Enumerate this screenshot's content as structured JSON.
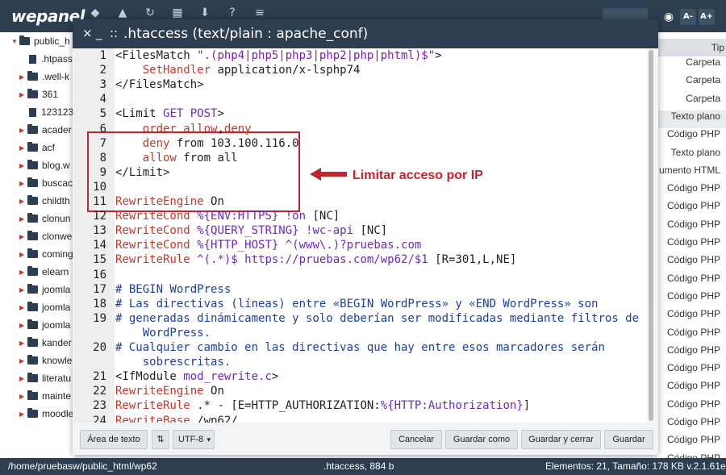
{
  "topbar": {
    "logo": "wepanel",
    "icons": [
      "home-icon",
      "upload-icon",
      "refresh-icon",
      "grid-icon",
      "download-icon",
      "help-icon",
      "settings-icon"
    ],
    "font_decrease": "A-",
    "font_increase": "A+"
  },
  "tree": {
    "items": [
      {
        "label": "public_h",
        "type": "folder",
        "expanded": true
      },
      {
        "label": ".htpass",
        "type": "file"
      },
      {
        "label": ".well-k",
        "type": "folder"
      },
      {
        "label": "361",
        "type": "folder"
      },
      {
        "label": "123123",
        "type": "file"
      },
      {
        "label": "acader",
        "type": "folder"
      },
      {
        "label": "acf",
        "type": "folder"
      },
      {
        "label": "blog.w",
        "type": "folder"
      },
      {
        "label": "buscac",
        "type": "folder"
      },
      {
        "label": "childth",
        "type": "folder"
      },
      {
        "label": "clonun",
        "type": "folder"
      },
      {
        "label": "clonwe",
        "type": "folder"
      },
      {
        "label": "coming",
        "type": "folder"
      },
      {
        "label": "elearn",
        "type": "folder"
      },
      {
        "label": "joomla",
        "type": "folder"
      },
      {
        "label": "joomla",
        "type": "folder"
      },
      {
        "label": "joomla",
        "type": "folder"
      },
      {
        "label": "kander",
        "type": "folder"
      },
      {
        "label": "knowle",
        "type": "folder"
      },
      {
        "label": "literatu",
        "type": "folder"
      },
      {
        "label": "mainte",
        "type": "folder"
      },
      {
        "label": "moodle",
        "type": "folder"
      }
    ]
  },
  "list": {
    "header": "Tip",
    "rows": [
      "Carpeta",
      "Carpeta",
      "Carpeta",
      "Texto plano",
      "Código PHP",
      "Texto plano",
      "umento HTML",
      "Código PHP",
      "Código PHP",
      "Código PHP",
      "Código PHP",
      "Código PHP",
      "Código PHP",
      "Código PHP",
      "Código PHP",
      "Código PHP",
      "Código PHP",
      "Código PHP",
      "Código PHP",
      "Código PHP",
      "Código PHP",
      "Código PHP",
      "Código PHP"
    ]
  },
  "status": {
    "path": "/home/pruebasw/public_html/wp62",
    "file": ".htaccess, 884 b",
    "summary": "Elementos: 21, Tamaño: 178 KB v.2.1.61e"
  },
  "modal": {
    "close": "×",
    "minimize": "_",
    "fullscreen": "::",
    "title": ".htaccess (text/plain : apache_conf)",
    "annotation": "Limitar acceso por IP",
    "footer": {
      "textarea_btn": "Área de texto",
      "encoding": "UTF-8",
      "cancel": "Cancelar",
      "save_as": "Guardar como",
      "save_close": "Guardar y cerrar",
      "save": "Guardar"
    }
  },
  "code": {
    "line_numbers": [
      "1",
      "2",
      "3",
      "4",
      "5",
      "6",
      "7",
      "8",
      "9",
      "10",
      "11",
      "12",
      "13",
      "14",
      "15",
      "16",
      "17",
      "18",
      "19",
      "",
      "20",
      "",
      "21",
      "22",
      "23",
      "24"
    ],
    "lines": [
      [
        {
          "t": "<FilesMatch ",
          "c": "t"
        },
        {
          "t": "\".(php4|php5|php3|php2|php|phtml)$\"",
          "c": "s"
        },
        {
          "t": ">",
          "c": "t"
        }
      ],
      [
        {
          "t": "    SetHandler ",
          "c": "k"
        },
        {
          "t": "application/x-lsphp74",
          "c": "t"
        }
      ],
      [
        {
          "t": "</FilesMatch>",
          "c": "t"
        }
      ],
      [],
      [
        {
          "t": "<Limit ",
          "c": "t"
        },
        {
          "t": "GET POST",
          "c": "v"
        },
        {
          "t": ">",
          "c": "t"
        }
      ],
      [
        {
          "t": "    order ",
          "c": "k"
        },
        {
          "t": "allow",
          "c": "k"
        },
        {
          "t": ",",
          "c": "t"
        },
        {
          "t": "deny",
          "c": "k"
        }
      ],
      [
        {
          "t": "    deny ",
          "c": "k"
        },
        {
          "t": "from 103.100.116.0",
          "c": "t"
        }
      ],
      [
        {
          "t": "    allow ",
          "c": "k"
        },
        {
          "t": "from all",
          "c": "t"
        }
      ],
      [
        {
          "t": "</Limit>",
          "c": "t"
        }
      ],
      [],
      [
        {
          "t": "RewriteEngine ",
          "c": "k"
        },
        {
          "t": "On",
          "c": "t"
        }
      ],
      [
        {
          "t": "RewriteCond ",
          "c": "k"
        },
        {
          "t": "%{ENV:HTTPS}",
          "c": "v"
        },
        {
          "t": " !on ",
          "c": "v"
        },
        {
          "t": "[NC]",
          "c": "t"
        }
      ],
      [
        {
          "t": "RewriteCond ",
          "c": "k"
        },
        {
          "t": "%{QUERY_STRING}",
          "c": "v"
        },
        {
          "t": " !wc-api ",
          "c": "v"
        },
        {
          "t": "[NC]",
          "c": "t"
        }
      ],
      [
        {
          "t": "RewriteCond ",
          "c": "k"
        },
        {
          "t": "%{HTTP_HOST}",
          "c": "v"
        },
        {
          "t": " ^(www\\.)?pruebas.com",
          "c": "v"
        }
      ],
      [
        {
          "t": "RewriteRule ",
          "c": "k"
        },
        {
          "t": "^(.*)$ https://pruebas.com/wp62/$1 ",
          "c": "v"
        },
        {
          "t": "[R=301,L,NE]",
          "c": "t"
        }
      ],
      [],
      [
        {
          "t": "# BEGIN WordPress",
          "c": "c"
        }
      ],
      [
        {
          "t": "# Las directivas (líneas) entre «BEGIN WordPress» y «END WordPress» son",
          "c": "c"
        }
      ],
      [
        {
          "t": "# generadas dinámicamente y solo deberían ser modificadas mediante filtros de",
          "c": "c"
        }
      ],
      [
        {
          "t": "    WordPress.",
          "c": "c"
        }
      ],
      [
        {
          "t": "# Cualquier cambio en las directivas que hay entre esos marcadores serán",
          "c": "c"
        }
      ],
      [
        {
          "t": "    sobrescritas.",
          "c": "c"
        }
      ],
      [
        {
          "t": "<IfModule ",
          "c": "t"
        },
        {
          "t": "mod_rewrite.c",
          "c": "v"
        },
        {
          "t": ">",
          "c": "t"
        }
      ],
      [
        {
          "t": "RewriteEngine ",
          "c": "k"
        },
        {
          "t": "On",
          "c": "t"
        }
      ],
      [
        {
          "t": "RewriteRule ",
          "c": "k"
        },
        {
          "t": ".* - ",
          "c": "t"
        },
        {
          "t": "[E=HTTP_AUTHORIZATION:",
          "c": "t"
        },
        {
          "t": "%{HTTP:Authorization}",
          "c": "v"
        },
        {
          "t": "]",
          "c": "t"
        }
      ],
      [
        {
          "t": "RewriteBase ",
          "c": "k"
        },
        {
          "t": "/wp62/",
          "c": "t"
        }
      ]
    ]
  }
}
